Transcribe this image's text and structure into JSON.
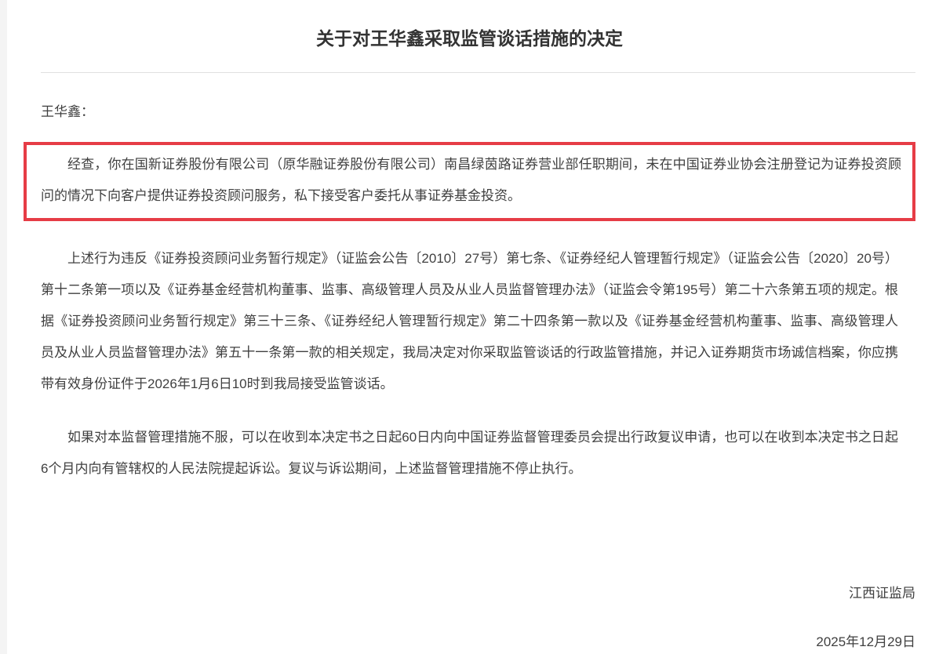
{
  "document": {
    "title": "关于对王华鑫采取监管谈话措施的决定",
    "salutation": "王华鑫：",
    "paragraph_highlighted": "经查，你在国新证券股份有限公司（原华融证券股份有限公司）南昌绿茵路证券营业部任职期间，未在中国证券业协会注册登记为证券投资顾问的情况下向客户提供证券投资顾问服务，私下接受客户委托从事证券基金投资。",
    "paragraph_basis": "上述行为违反《证券投资顾问业务暂行规定》（证监会公告〔2010〕27号）第七条、《证券经纪人管理暂行规定》（证监会公告〔2020〕20号）第十二条第一项以及《证券基金经营机构董事、监事、高级管理人员及从业人员监督管理办法》（证监会令第195号）第二十六条第五项的规定。根据《证券投资顾问业务暂行规定》第三十三条、《证券经纪人管理暂行规定》第二十四条第一款以及《证券基金经营机构董事、监事、高级管理人员及从业人员监督管理办法》第五十一条第一款的相关规定，我局决定对你采取监管谈话的行政监管措施，并记入证券期货市场诚信档案，你应携带有效身份证件于2026年1月6日10时到我局接受监管谈话。",
    "paragraph_appeal": "如果对本监督管理措施不服，可以在收到本决定书之日起60日内向中国证券监督管理委员会提出行政复议申请，也可以在收到本决定书之日起6个月内向有管辖权的人民法院提起诉讼。复议与诉讼期间，上述监督管理措施不停止执行。",
    "signature": "江西证监局",
    "date": "2025年12月29日",
    "colors": {
      "highlight_border": "#e63c46",
      "body_text": "#404040",
      "title_text": "#333333",
      "divider": "#e0e0e0"
    }
  }
}
